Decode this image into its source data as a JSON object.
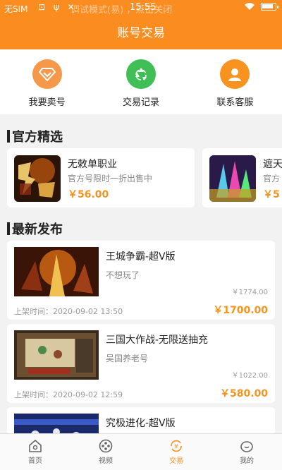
{
  "statusbar": {
    "sim": "无SIM",
    "icons": "⊡ ψ ✕",
    "debug_text": "调试模式(易)   ，点击关闭",
    "time": "15:55",
    "battery_level": 0.9
  },
  "header": {
    "title": "账号交易"
  },
  "quick": [
    {
      "label": "我要卖号",
      "icon": "diamond-icon",
      "color": "#f5984a"
    },
    {
      "label": "交易记录",
      "icon": "recycle-icon",
      "color": "#3fbf55"
    },
    {
      "label": "联系客服",
      "icon": "user-service-icon",
      "color": "#f7931e"
    }
  ],
  "official": {
    "title": "官方精选",
    "items": [
      {
        "name": "无敕单职业",
        "desc": "官方号限时一折出售中",
        "price": "￥56.00"
      },
      {
        "name": "遮天",
        "desc": "官方",
        "price": "￥5"
      }
    ]
  },
  "latest": {
    "title": "最新发布",
    "items": [
      {
        "name": "王城争霸-超V版",
        "desc": "不想玩了",
        "orig_price": "￥1774.00",
        "time": "上架时间：2020-09-02 13:50",
        "price": "￥1700.00"
      },
      {
        "name": "三国大作战-无限送抽充",
        "desc": "吴国养老号",
        "orig_price": "￥1022.00",
        "time": "上架时间：2020-09-02 12:59",
        "price": "￥580.00"
      },
      {
        "name": "究极进化-超V版",
        "desc": "",
        "orig_price": "",
        "time": "",
        "price": ""
      }
    ]
  },
  "tabs": [
    {
      "label": "首页",
      "icon": "home-icon"
    },
    {
      "label": "视频",
      "icon": "video-icon"
    },
    {
      "label": "交易",
      "icon": "trade-icon",
      "active": true
    },
    {
      "label": "我的",
      "icon": "profile-icon"
    }
  ],
  "colors": {
    "brand": "#fb8c1f",
    "price": "#f7931e"
  }
}
